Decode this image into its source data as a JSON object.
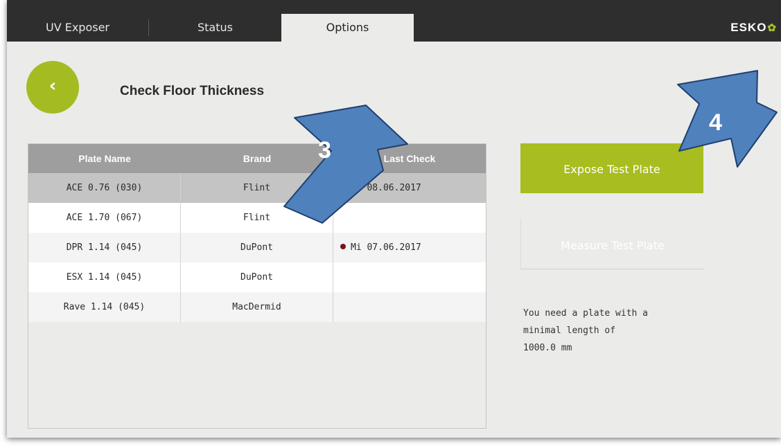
{
  "tabs": [
    {
      "label": "UV Exposer",
      "active": false
    },
    {
      "label": "Status",
      "active": false
    },
    {
      "label": "Options",
      "active": true
    }
  ],
  "brand": {
    "name": "ESKO",
    "mark": "✿"
  },
  "back_icon": "chevron-left-icon",
  "page_title": "Check Floor Thickness",
  "table": {
    "columns": [
      "Plate Name",
      "Brand",
      "Last Check"
    ],
    "rows": [
      {
        "plate": "ACE 0.76 (030)",
        "brand": "Flint",
        "last_check": "Do 08.06.2017",
        "selected": true,
        "status_dot": true
      },
      {
        "plate": "ACE 1.70 (067)",
        "brand": "Flint",
        "last_check": "",
        "selected": false,
        "status_dot": false
      },
      {
        "plate": "DPR 1.14 (045)",
        "brand": "DuPont",
        "last_check": "Mi 07.06.2017",
        "selected": false,
        "status_dot": true
      },
      {
        "plate": "ESX 1.14 (045)",
        "brand": "DuPont",
        "last_check": "",
        "selected": false,
        "status_dot": false
      },
      {
        "plate": "Rave 1.14 (045)",
        "brand": "MacDermid",
        "last_check": "",
        "selected": false,
        "status_dot": false
      }
    ]
  },
  "actions": {
    "expose_label": "Expose Test Plate",
    "measure_label": "Measure Test Plate",
    "measure_enabled": false
  },
  "info": {
    "line1": "You need a plate with a",
    "line2": "minimal length of",
    "line3": "1000.0 mm"
  },
  "annotations": {
    "arrow_3": "3",
    "arrow_4": "4"
  },
  "colors": {
    "accent_green": "#a8bd1f",
    "topbar": "#2e2e2e",
    "header_gray": "#9e9e9e",
    "status_dot": "#7a1414",
    "callout_blue": "#4f81bd"
  }
}
